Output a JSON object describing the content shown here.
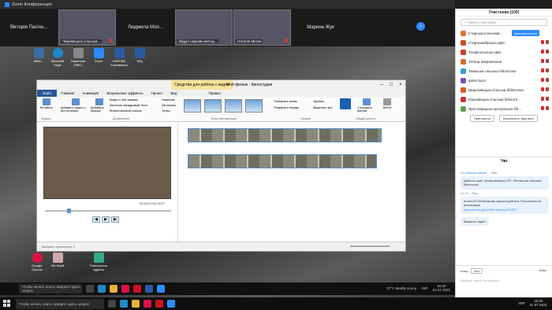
{
  "window": {
    "title": "Zoom Конференция"
  },
  "strip": {
    "tiles": [
      {
        "name": "Вікторія Пасічн...",
        "video": false
      },
      {
        "name": "Чернівецька сільська...",
        "video": true
      },
      {
        "name": "Людмила Мол...",
        "video": false
      },
      {
        "name": "Відділ науково-метод...",
        "video": true
      },
      {
        "name": "Наталія Мисик",
        "video": true
      },
      {
        "name": "Марина Жук",
        "video": false
      }
    ]
  },
  "desktop_icons": [
    {
      "label": "Meta...",
      "color": "#3b6ea5"
    },
    {
      "label": "Microsoft Edge",
      "color": "#1e88c8"
    },
    {
      "label": "Українські (ФВС)",
      "color": "#888"
    },
    {
      "label": "Zoom",
      "color": "#2d8cff"
    },
    {
      "label": "ВІ/ВТ/ВК Копіювання",
      "color": "#2a5aa0"
    },
    {
      "label": "ФІЦ",
      "color": "#2a5aa0"
    },
    {
      "label": "Google Chrome",
      "color": "#d14"
    },
    {
      "label": "ФА Юрій",
      "color": "#caa"
    },
    {
      "label": "Електронна адреса",
      "color": "#3a8"
    }
  ],
  "movie_maker": {
    "context_tab": "Средства для работы с видео",
    "title": "Мой фильм - Киностудия",
    "tabs": [
      "Файл",
      "Главная",
      "Анимация",
      "Визуальные эффекты",
      "Проект",
      "Вид",
      "Правка"
    ],
    "ribbon": {
      "paste": "Вставить",
      "clipboard": "Буфер",
      "add_video": "Добавить видео и фотографии",
      "add_music": "Добавить музыку",
      "webcam": "Видео с веб-камеры",
      "voiceover": "Записать закадровый текст",
      "snapshot": "Моментальный снимок",
      "title_lbl": "Название",
      "caption": "Заголовок",
      "credits": "Титры",
      "add_group": "Добавление",
      "themes_group": "Темы автофильма",
      "rotate_left": "Повернуть влево",
      "rotate_right": "Повернуть вправо",
      "delete": "Удалить",
      "select_all": "Выделить все",
      "edit_group": "Правка",
      "save_movie": "Сохранить фильм",
      "signin": "Войти",
      "share_group": "Общий доступ"
    },
    "player": {
      "time": "00:22,07/01:08,27"
    },
    "status": "Выбрано элементов: 2"
  },
  "taskbar_inner": {
    "search": "Чтобы начать поиск, введите здесь запрос",
    "weather": "37°C  Mostly sunny",
    "lang": "УКР",
    "time": "16:20",
    "date": "21.07.2021"
  },
  "panel": {
    "title": "Участники (100)",
    "search_placeholder": "Найти участника",
    "participants": [
      {
        "name": "Староконстянтинів...",
        "color": "#e07030",
        "button": "Дополнительно",
        "more": "›"
      },
      {
        "name": "Старосамбірська ЦБС",
        "color": "#d04a2a"
      },
      {
        "name": "Теофіпольська ЦБС",
        "color": "#c4452b"
      },
      {
        "name": "Тетяна Закревчинна",
        "color": "#d86a30"
      },
      {
        "name": "Тиниська сільська бібліотека",
        "color": "#2f9fcf"
      },
      {
        "name": "філія №14",
        "color": "#7b4fc2"
      },
      {
        "name": "Шидловецька сільська бібліотека",
        "color": "#e05a20"
      },
      {
        "name": "Юрковецька сільська бібліоте...",
        "color": "#c23535"
      },
      {
        "name": "Ярославицька центральна біб...",
        "color": "#5da34a"
      }
    ],
    "invite": "Пригласить",
    "mute_all": "Выключить звук всех"
  },
  "chat": {
    "title": "Чат",
    "messages": [
      {
        "from": "От",
        "sender": "Наталія Мисик",
        "to": "Все",
        "text": "Доброго дня! Чемеровецька ОТГ, Летавська сільська бібліотека"
      },
      {
        "from": "От",
        "sender": "Я",
        "to": "Все",
        "text": "Колеги!!! Обов'язково зареєструйтеся. Посилання на реєстрацію",
        "link": "https://forms.gle/vMkSnSzmopXKVB7"
      },
      {
        "text2": "Вимкніть звук!!!"
      }
    ],
    "to_label": "Кому:",
    "to_value": "Все",
    "file": "Файл",
    "compose_placeholder": "Введите здесь сообщение..."
  },
  "taskbar": {
    "search": "Чтобы начать поиск, введите здесь запрос",
    "lang": "УКР",
    "time": "16:20",
    "date": "21.07.2021"
  }
}
